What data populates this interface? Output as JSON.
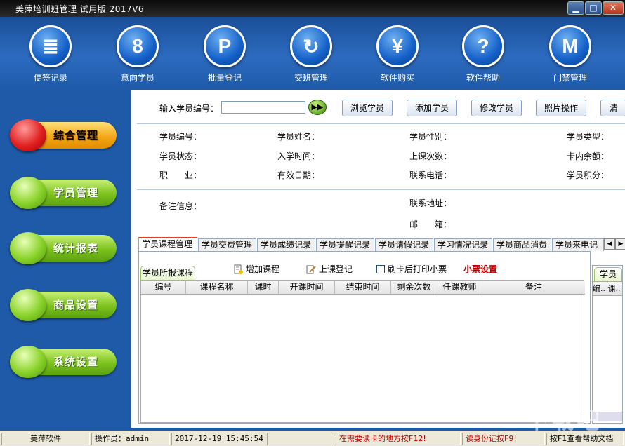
{
  "window": {
    "title": "美萍培训班管理 试用版   2017V6",
    "min": "▁",
    "max": "□",
    "close": "✕"
  },
  "toolbar": {
    "items": [
      {
        "label": "便签记录",
        "glyph": "≣",
        "icon": "notepad-icon"
      },
      {
        "label": "意向学员",
        "glyph": "8",
        "icon": "person-icon"
      },
      {
        "label": "批量登记",
        "glyph": "P",
        "icon": "p-icon"
      },
      {
        "label": "交班管理",
        "glyph": "↻",
        "icon": "refresh-icon"
      },
      {
        "label": "软件购买",
        "glyph": "¥",
        "icon": "yen-icon"
      },
      {
        "label": "软件帮助",
        "glyph": "?",
        "icon": "help-icon"
      },
      {
        "label": "门禁管理",
        "glyph": "M",
        "icon": "m-icon"
      }
    ]
  },
  "nav": {
    "items": [
      {
        "label": "综合管理",
        "active": true
      },
      {
        "label": "学员管理",
        "active": false
      },
      {
        "label": "统计报表",
        "active": false
      },
      {
        "label": "商品设置",
        "active": false
      },
      {
        "label": "系统设置",
        "active": false
      }
    ]
  },
  "search": {
    "label": "输入学员编号：",
    "value": "",
    "go": "▶▶",
    "buttons": [
      "浏览学员",
      "添加学员",
      "修改学员",
      "照片操作",
      "清"
    ]
  },
  "info": {
    "student_no": "学员编号：",
    "student_name": "学员姓名：",
    "gender": "学员性别：",
    "type": "学员类型：",
    "status": "学员状态：",
    "enroll_time": "入学时间：",
    "class_count": "上课次数：",
    "card_balance": "卡内余额：",
    "occupation": "职　　业：",
    "valid_date": "有效日期：",
    "phone": "联系电话：",
    "points": "学员积分：",
    "remark": "备注信息：",
    "address": "联系地址：",
    "postcode": "邮　　箱："
  },
  "tabs": [
    "学员课程管理",
    "学员交费管理",
    "学员成绩记录",
    "学员提醒记录",
    "学员请假记录",
    "学习情况记录",
    "学员商品消费",
    "学员来电记"
  ],
  "tab_arrows": {
    "left": "◀",
    "right": "▶"
  },
  "course_panel": {
    "subtab": "学员所报课程",
    "add_course": "增加课程",
    "class_register": "上课登记",
    "print_receipt": "刷卡后打印小票",
    "receipt_settings": "小票设置",
    "columns": [
      "编号",
      "课程名称",
      "课时",
      "开课时间",
      "结束时间",
      "剩余次数",
      "任课教师",
      "备注"
    ]
  },
  "side_panel": {
    "tab": "学员",
    "head": "编.. 课.."
  },
  "status": {
    "company": "美萍软件",
    "operator_label": "操作员：",
    "operator": "admin",
    "datetime": "2017-12-19 15:45:54",
    "empty": "",
    "read_card_hint": "在需要读卡的地方按F12!",
    "id_card_hint": "读身份证按F9!",
    "help_hint": "按F1查看帮助文档"
  },
  "watermark": "下载吧"
}
